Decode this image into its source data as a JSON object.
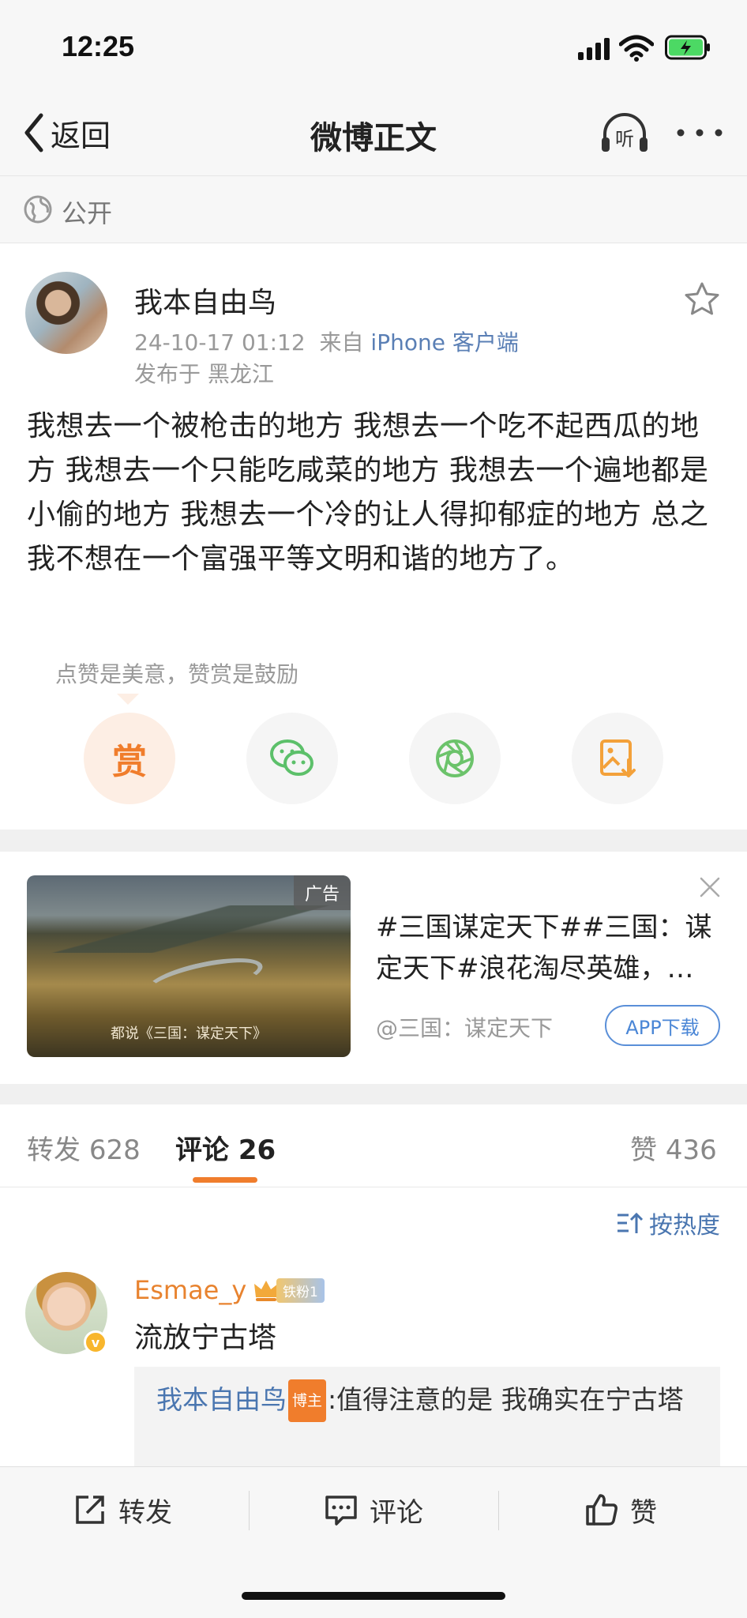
{
  "status_bar": {
    "time": "12:25"
  },
  "nav": {
    "back_label": "返回",
    "title": "微博正文",
    "listen_label": "听"
  },
  "visibility": {
    "label": "公开"
  },
  "post": {
    "author": "我本自由鸟",
    "time": "24-10-17 01:12",
    "from_prefix": "来自",
    "client": "iPhone 客户端",
    "location": "发布于 黑龙江",
    "text": "我想去一个被枪击的地方 我想去一个吃不起西瓜的地方 我想去一个只能吃咸菜的地方 我想去一个遍地都是小偷的地方 我想去一个冷的让人得抑郁症的地方 总之我不想在一个富强平等文明和谐的地方了。"
  },
  "reward": {
    "tip": "点赞是美意，赞赏是鼓励",
    "reward_glyph": "赏",
    "share_icons": [
      "reward-icon",
      "wechat-icon",
      "moments-icon",
      "save-image-icon"
    ]
  },
  "ad": {
    "badge": "广告",
    "image_caption": "都说《三国：谋定天下》",
    "title": "#三国谋定天下##三国：谋定天下#浪花淘尽英雄，…",
    "source": "@三国：谋定天下",
    "button": "APP下载"
  },
  "tabs": {
    "repost_label": "转发",
    "repost_count": "628",
    "comment_label": "评论",
    "comment_count": "26",
    "like_label": "赞",
    "like_count": "436"
  },
  "sort": {
    "label": "按热度"
  },
  "comment": {
    "name": "Esmae_y",
    "fan_badge": "铁粉1",
    "text": "流放宁古塔",
    "reply": {
      "name": "我本自由鸟",
      "host_tag": "博主",
      "text": ":值得注意的是 我确实在宁古塔"
    }
  },
  "bottom_bar": {
    "repost": "转发",
    "comment": "评论",
    "like": "赞"
  },
  "colors": {
    "accent_orange": "#f07d2c",
    "link_blue": "#4a76b0",
    "background": "#f7f7f7"
  }
}
